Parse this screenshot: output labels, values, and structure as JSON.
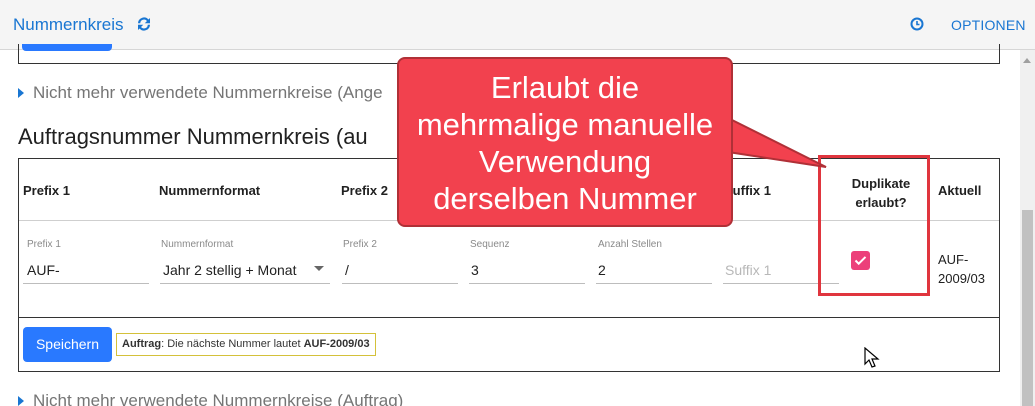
{
  "header": {
    "title": "Nummernkreis",
    "options_label": "OPTIONEN"
  },
  "sections": {
    "unused_top": "Nicht mehr verwendete Nummernkreise (Ange",
    "heading": "Auftragsnummer Nummernkreis (au",
    "unused_bottom": "Nicht mehr verwendete Nummernkreise (Auftrag)"
  },
  "table": {
    "headers": {
      "prefix1": "Prefix 1",
      "format": "Nummernformat",
      "prefix2": "Prefix 2",
      "suffix1": "Suffix 1",
      "duplicates_line1": "Duplikate",
      "duplicates_line2": "erlaubt?",
      "current": "Aktuell"
    },
    "fields": {
      "prefix1": {
        "label": "Prefix 1",
        "value": "AUF-"
      },
      "format": {
        "label": "Nummernformat",
        "value": "Jahr 2 stellig + Monat"
      },
      "prefix2": {
        "label": "Prefix 2",
        "value": "/"
      },
      "sequence": {
        "label": "Sequenz",
        "value": "3"
      },
      "digits": {
        "label": "Anzahl Stellen",
        "value": "2"
      },
      "suffix1": {
        "placeholder": "Suffix 1"
      }
    },
    "duplicates_allowed": true,
    "current_line1": "AUF-",
    "current_line2": "2009/03"
  },
  "footer": {
    "save_label": "Speichern",
    "info_prefix": "Auftrag",
    "info_text": ": Die nächste Nummer lautet ",
    "info_number": "AUF-2009/03"
  },
  "callout": {
    "line1": "Erlaubt die",
    "line2": "mehrmalige manuelle",
    "line3": "Verwendung",
    "line4": "derselben Nummer"
  },
  "colors": {
    "brand": "#1976d2",
    "primary_button": "#2979ff",
    "checkbox": "#ec407a",
    "callout": "#f2414e"
  }
}
